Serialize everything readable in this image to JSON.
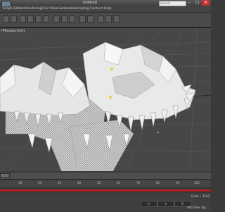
{
  "window": {
    "title": "Untitled",
    "search_placeholder": "Search",
    "controls": [
      "–",
      "□",
      "✕"
    ]
  },
  "menubar": {
    "items": [
      {
        "label": "Graph Editors"
      },
      {
        "label": "Rendering"
      },
      {
        "label": "Civil View"
      },
      {
        "label": "Customize"
      },
      {
        "label": "Scripting"
      },
      {
        "label": "Content"
      },
      {
        "label": "Help"
      }
    ]
  },
  "viewport": {
    "label": "[Perspective]",
    "model": "creature-mesh"
  },
  "timeline": {
    "ticks": [
      "10",
      "20",
      "30",
      "40",
      "50",
      "60",
      "70",
      "80",
      "90",
      "100"
    ]
  },
  "statusbar": {
    "coords": [
      "X:",
      "Y:",
      "Z:"
    ],
    "add_time_tag": "Add Time Tag",
    "grid": "Grid = 10.0"
  },
  "colors": {
    "accent_red": "#b51f1f",
    "close_button": "#c8302c",
    "viewport_bg": "#474747",
    "mesh": "#d9d9d9"
  }
}
